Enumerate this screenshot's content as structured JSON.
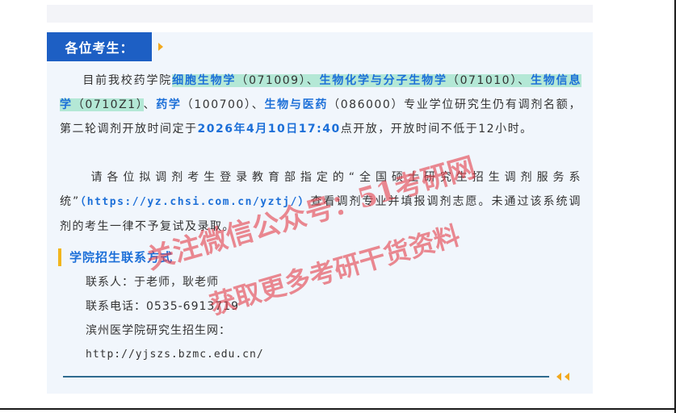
{
  "header": {
    "title": "各位考生："
  },
  "paragraph1": {
    "intro": "目前我校药学院",
    "major1": "细胞生物学",
    "code1": "（071009）、",
    "major2": "生物化学与分子生物学",
    "code2": "（071010）、",
    "major3": "生物信息学",
    "code3": "（0710Z1）",
    "sep3": "、",
    "major4": "药学",
    "code4": "（100700）、",
    "major5": "生物与医药",
    "code5": "（086000）专业学位研究生仍有调剂名额，第二轮调剂开放时间定于",
    "datetime": "2026年4月10日17:40",
    "tail": "点开放，开放时间不低于12小时。"
  },
  "paragraph2": {
    "intro": "请各位拟调剂考生登录教育部指定的“全国硕士研究生招生调剂服务系统”",
    "url": "（https://yz.chsi.com.cn/yztj/）",
    "tail": "查看调剂专业并填报调剂志愿。未通过该系统调剂的考生一律不予复试及录取。"
  },
  "section": {
    "title": "学院招生联系方式"
  },
  "contacts": {
    "person": "联系人：于老师，耿老师",
    "phone": "联系电话：0535-6913719",
    "site_label": "滨州医学院研究生招生网：",
    "site_url": "http://yjszs.bzmc.edu.cn/"
  },
  "watermark": {
    "line1": "关注微信公众号：51考研网",
    "line2": "获取更多考研干货资料"
  },
  "colors": {
    "header_bg": "#1d5fc4",
    "accent_blue": "#1c6fd8",
    "highlight": "#b4e8d6",
    "arrow_orange": "#f2a81d",
    "watermark_red": "#e4424e"
  }
}
